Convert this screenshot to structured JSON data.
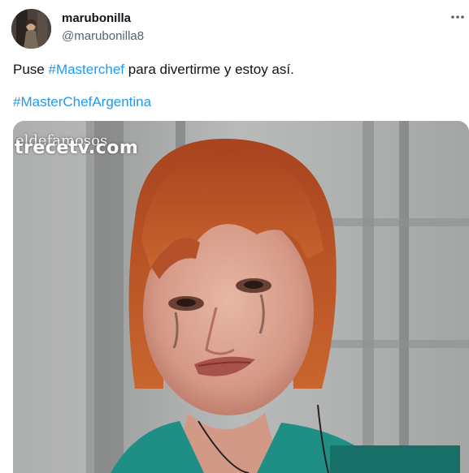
{
  "user": {
    "display_name": "marubonilla",
    "handle": "@marubonilla8"
  },
  "tweet": {
    "line1_prefix": "Puse ",
    "line1_hashtag": "#Masterchef",
    "line1_suffix": " para divertirme y estoy así.",
    "line2_hashtag": "#MasterChefArgentina"
  },
  "media": {
    "watermark_small": "eldefamosos",
    "watermark_main": "trecetv.com"
  },
  "icons": {
    "more": "more-options-icon"
  },
  "colors": {
    "hashtag": "#1d9bf0",
    "secondary_text": "#536471"
  }
}
